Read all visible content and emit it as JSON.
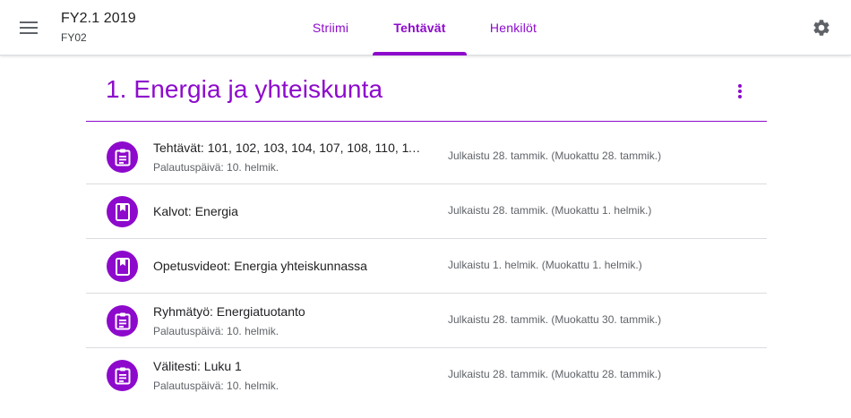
{
  "header": {
    "class_title": "FY2.1 2019",
    "class_section": "FY02",
    "menu_icon": "hamburger-menu-icon",
    "settings_icon": "gear-icon",
    "accent_color": "#8d0acc"
  },
  "tabs": [
    {
      "label": "Striimi",
      "active": false
    },
    {
      "label": "Tehtävät",
      "active": true
    },
    {
      "label": "Henkilöt",
      "active": false
    }
  ],
  "topic": {
    "title": "1. Energia ja yhteiskunta",
    "more_icon": "more-vert-icon"
  },
  "items": [
    {
      "icon": "assignment-icon",
      "title": "Tehtävät: 101, 102, 103, 104, 107, 108, 110, 11...",
      "due": "Palautuspäivä: 10. helmik.",
      "meta": "Julkaistu 28. tammik. (Muokattu 28. tammik.)"
    },
    {
      "icon": "material-icon",
      "title": "Kalvot: Energia",
      "due": "",
      "meta": "Julkaistu 28. tammik. (Muokattu 1. helmik.)"
    },
    {
      "icon": "material-icon",
      "title": "Opetusvideot: Energia yhteiskunnassa",
      "due": "",
      "meta": "Julkaistu 1. helmik. (Muokattu 1. helmik.)"
    },
    {
      "icon": "assignment-icon",
      "title": "Ryhmätyö: Energiatuotanto",
      "due": "Palautuspäivä: 10. helmik.",
      "meta": "Julkaistu 28. tammik. (Muokattu 30. tammik.)"
    },
    {
      "icon": "assignment-icon",
      "title": "Välitesti: Luku 1",
      "due": "Palautuspäivä: 10. helmik.",
      "meta": "Julkaistu 28. tammik. (Muokattu 28. tammik.)"
    }
  ]
}
